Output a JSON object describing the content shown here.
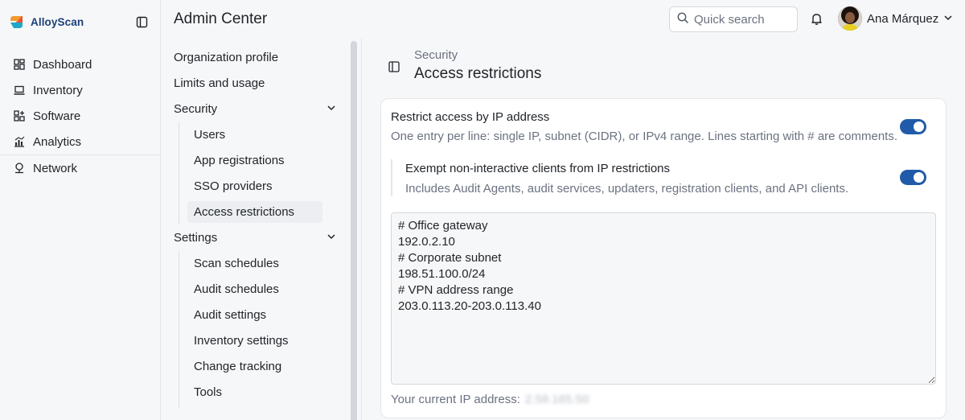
{
  "brand": {
    "name": "AlloyScan"
  },
  "app_nav": {
    "items": [
      {
        "label": "Dashboard",
        "icon": "grid-icon"
      },
      {
        "label": "Inventory",
        "icon": "laptop-icon"
      },
      {
        "label": "Software",
        "icon": "apps-icon"
      },
      {
        "label": "Analytics",
        "icon": "bar-chart-icon"
      },
      {
        "label": "Network",
        "icon": "network-icon"
      }
    ]
  },
  "header": {
    "title": "Admin Center",
    "search_placeholder": "Quick search",
    "user_name": "Ana Márquez"
  },
  "settings_nav": {
    "organization_profile": "Organization profile",
    "limits_usage": "Limits and usage",
    "security": {
      "label": "Security",
      "children": [
        "Users",
        "App registrations",
        "SSO providers",
        "Access restrictions"
      ]
    },
    "settings": {
      "label": "Settings",
      "children": [
        "Scan schedules",
        "Audit schedules",
        "Audit settings",
        "Inventory settings",
        "Change tracking",
        "Tools"
      ]
    }
  },
  "page": {
    "breadcrumb": "Security",
    "title": "Access restrictions"
  },
  "restrict_ip": {
    "title": "Restrict access by IP address",
    "description": "One entry per line: single IP, subnet (CIDR), or IPv4 range. Lines starting with # are comments.",
    "enabled": true
  },
  "exempt": {
    "title": "Exempt non-interactive clients from IP restrictions",
    "description": "Includes Audit Agents, audit services, updaters, registration clients, and API clients.",
    "enabled": true
  },
  "ip_list": "# Office gateway\n192.0.2.10\n# Corporate subnet\n198.51.100.0/24\n# VPN address range\n203.0.113.20-203.0.113.40",
  "current_ip": {
    "label": "Your current IP address:",
    "value": "2.59.165.50"
  },
  "colors": {
    "accent": "#1f5ba8",
    "brand_text": "#1c3f7a"
  }
}
